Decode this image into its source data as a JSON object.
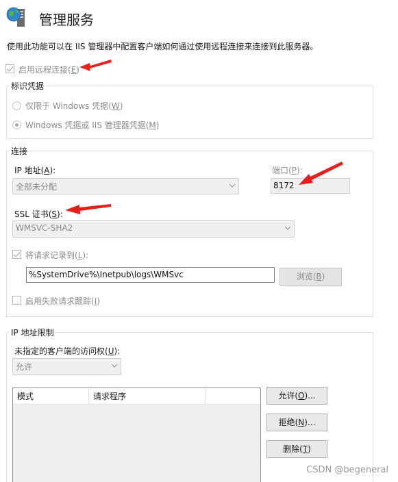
{
  "header": {
    "title": "管理服务",
    "description": "使用此功能可以在 IIS 管理器中配置客户端如何通过使用远程连接来连接到此服务器。"
  },
  "enable_remote": {
    "label_pre": "启用远程连接(",
    "mnemonic": "E",
    "label_post": ")",
    "checked": true
  },
  "identity": {
    "legend": "标识凭据",
    "option1": {
      "pre": "仅限于 Windows 凭据(",
      "mn": "W",
      "post": ")"
    },
    "option2": {
      "pre": "Windows 凭据或 IIS 管理器凭据(",
      "mn": "M",
      "post": ")"
    }
  },
  "connection": {
    "legend": "连接",
    "ip_label": {
      "pre": "IP 地址(",
      "mn": "A",
      "post": "):"
    },
    "ip_value": "全部未分配",
    "port_label": {
      "pre": "端口(",
      "mn": "P",
      "post": "):"
    },
    "port_value": "8172",
    "ssl_label": {
      "pre": "SSL 证书(",
      "mn": "S",
      "post": "):"
    },
    "ssl_value": "WMSVC-SHA2",
    "log_label": {
      "pre": "将请求记录到(",
      "mn": "L",
      "post": "):"
    },
    "log_path": "%SystemDrive%\\Inetpub\\logs\\WMSvc",
    "browse": {
      "pre": "浏览(",
      "mn": "B",
      "post": ")"
    },
    "failed_trace": {
      "pre": "启用失败请求跟踪(",
      "mn": "I",
      "post": ")"
    }
  },
  "ip_restrictions": {
    "legend": "IP 地址限制",
    "access_label": {
      "pre": "未指定的客户端的访问权(",
      "mn": "U",
      "post": "):"
    },
    "access_value": "允许",
    "columns": [
      "模式",
      "请求程序"
    ],
    "allow_btn": {
      "pre": "允许(",
      "mn": "O",
      "post": ")..."
    },
    "deny_btn": {
      "pre": "拒绝(",
      "mn": "N",
      "post": ")..."
    },
    "delete_btn": {
      "pre": "删除(",
      "mn": "T",
      "post": ")"
    }
  },
  "watermark": "CSDN @begeneral",
  "colors": {
    "arrow": "#e8201b",
    "disabled_text": "#8a8a8a"
  }
}
